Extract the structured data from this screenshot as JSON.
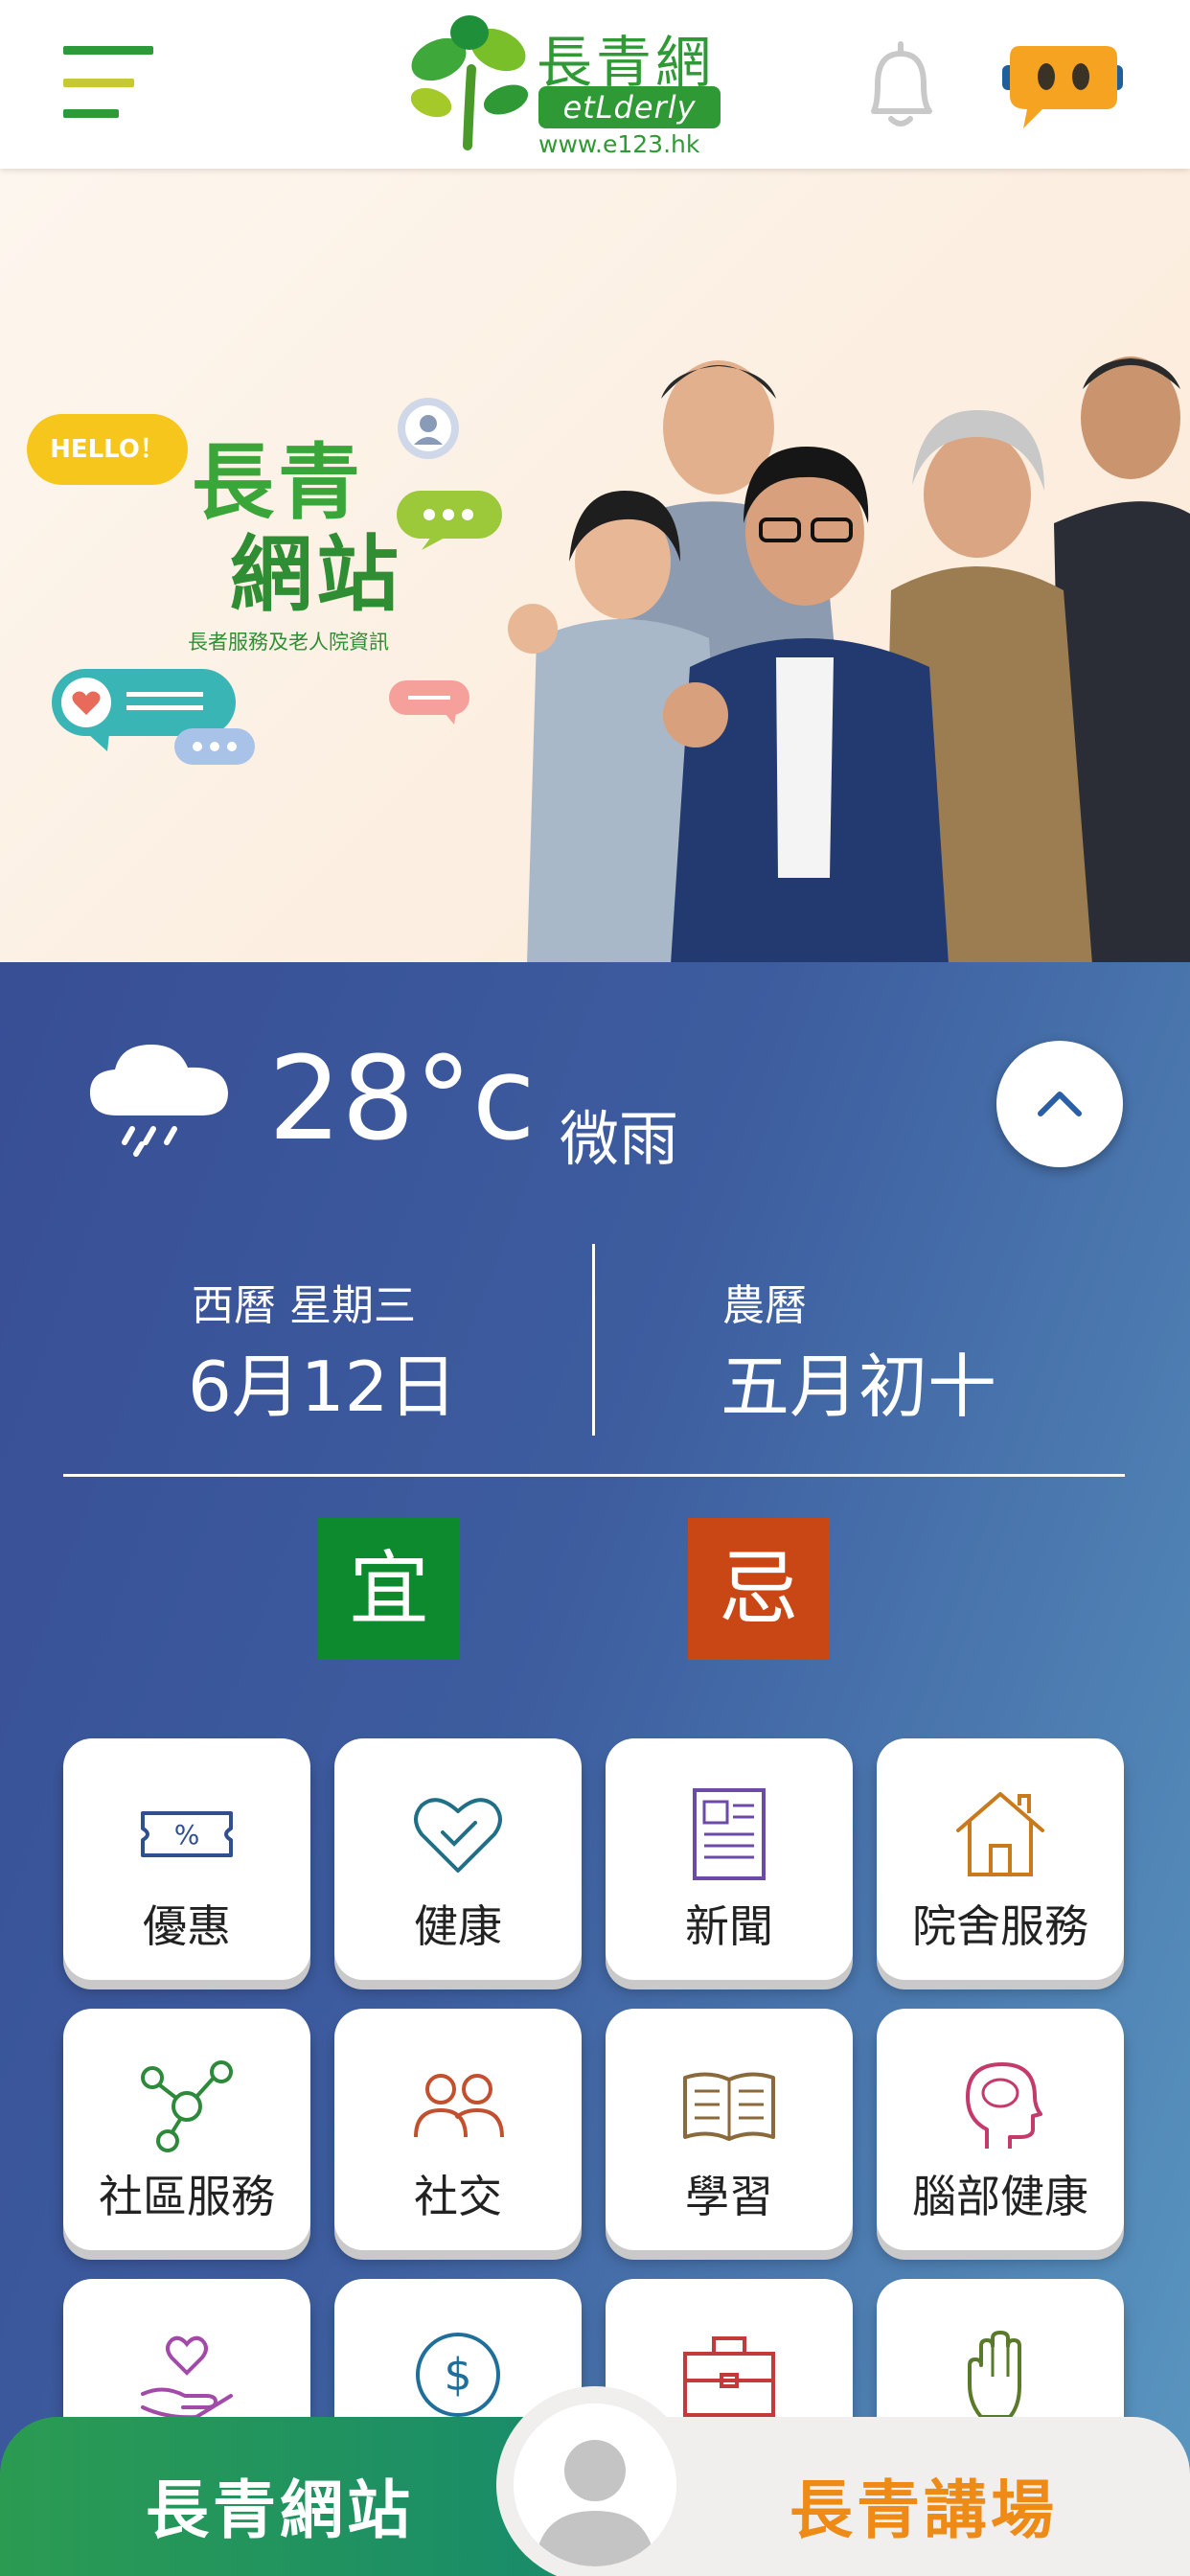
{
  "header": {
    "logo_title": "長青網",
    "logo_badge": "etLderly",
    "logo_url": "www.e123.hk"
  },
  "hero": {
    "hello": "HELLO！",
    "title_line1": "長青",
    "title_line2": "網站",
    "subtitle": "長者服務及老人院資訊"
  },
  "weather": {
    "temperature": "28°c",
    "condition": "微雨",
    "icon": "cloud-rain-icon"
  },
  "calendar": {
    "gregorian_label": "西曆 星期三",
    "gregorian_date": "6月12日",
    "lunar_label": "農曆",
    "lunar_date": "五月初十",
    "yi": "宜",
    "ji": "忌"
  },
  "tiles": [
    {
      "label": "優惠",
      "icon": "coupon-icon",
      "color": "#2f4f8f"
    },
    {
      "label": "健康",
      "icon": "heart-check-icon",
      "color": "#1f6f86"
    },
    {
      "label": "新聞",
      "icon": "newspaper-icon",
      "color": "#6c4aa8"
    },
    {
      "label": "院舍服務",
      "icon": "house-icon",
      "color": "#c97a1c"
    },
    {
      "label": "社區服務",
      "icon": "network-icon",
      "color": "#2d8a3a"
    },
    {
      "label": "社交",
      "icon": "people-icon",
      "color": "#c2502e"
    },
    {
      "label": "學習",
      "icon": "book-icon",
      "color": "#8a6a3a"
    },
    {
      "label": "腦部健康",
      "icon": "head-brain-icon",
      "color": "#c43a6a"
    },
    {
      "label": "",
      "icon": "hand-heart-icon",
      "color": "#a24aa8"
    },
    {
      "label": "",
      "icon": "dollar-icon",
      "color": "#1f6f9a"
    },
    {
      "label": "",
      "icon": "briefcase-icon",
      "color": "#c23a3a"
    },
    {
      "label": "",
      "icon": "hand-icon",
      "color": "#5a7a2a"
    }
  ],
  "bottom_nav": {
    "left": "長青網站",
    "right": "長青講場"
  }
}
